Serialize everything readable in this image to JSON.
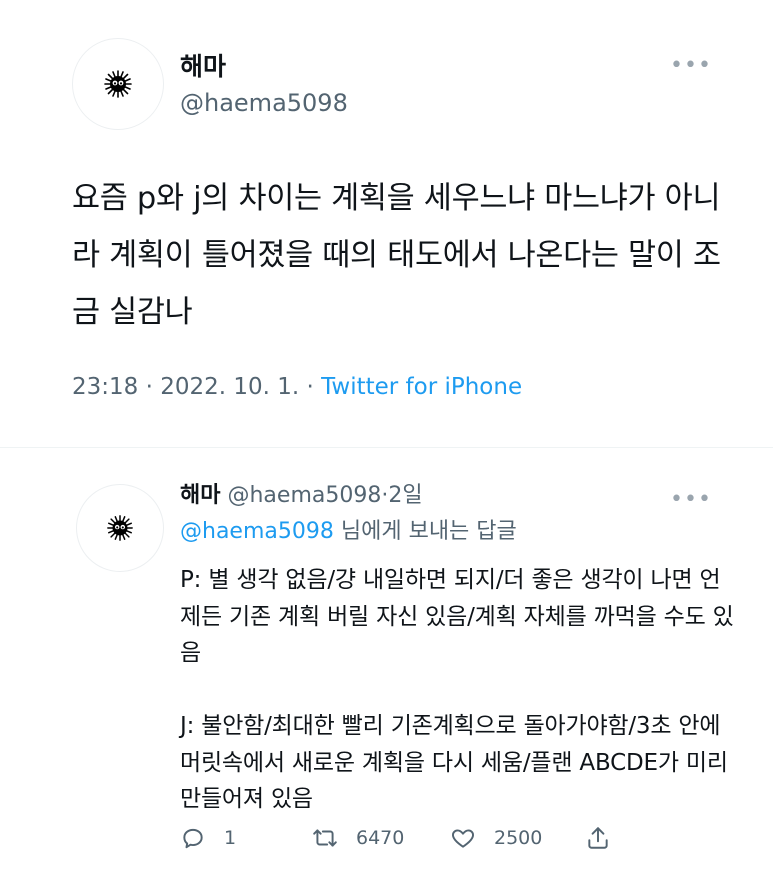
{
  "main_tweet": {
    "display_name": "해마",
    "handle": "@haema5098",
    "text": "요즘 p와 j의 차이는 계획을 세우느냐 마느냐가 아니라 계획이 틀어졌을 때의 태도에서 나온다는 말이 조금 실감나",
    "timestamp": "23:18 · 2022. 10. 1. · ",
    "source": "Twitter for iPhone",
    "avatar_icon": "soot-sprite-icon",
    "more_icon": "more-options-icon"
  },
  "reply": {
    "display_name": "해마",
    "handle": "@haema5098",
    "separator": "·",
    "time": "2일",
    "replying_mention": "@haema5098",
    "replying_suffix": " 님에게 보내는 답글",
    "text": "P: 별 생각 없음/걍 내일하면 되지/더 좋은 생각이 나면 언제든 기존 계획 버릴 자신 있음/계획 자체를 까먹을 수도 있음\n\nJ: 불안함/최대한 빨리 기존계획으로 돌아가야함/3초 안에 머릿속에서 새로운 계획을 다시 세움/플랜 ABCDE가 미리 만들어져 있음",
    "actions": {
      "reply_count": "1",
      "retweet_count": "6470",
      "like_count": "2500"
    }
  },
  "colors": {
    "accent": "#1d9bf0",
    "secondary_text": "#536471",
    "primary_text": "#0f1419",
    "background": "#ffffff"
  }
}
